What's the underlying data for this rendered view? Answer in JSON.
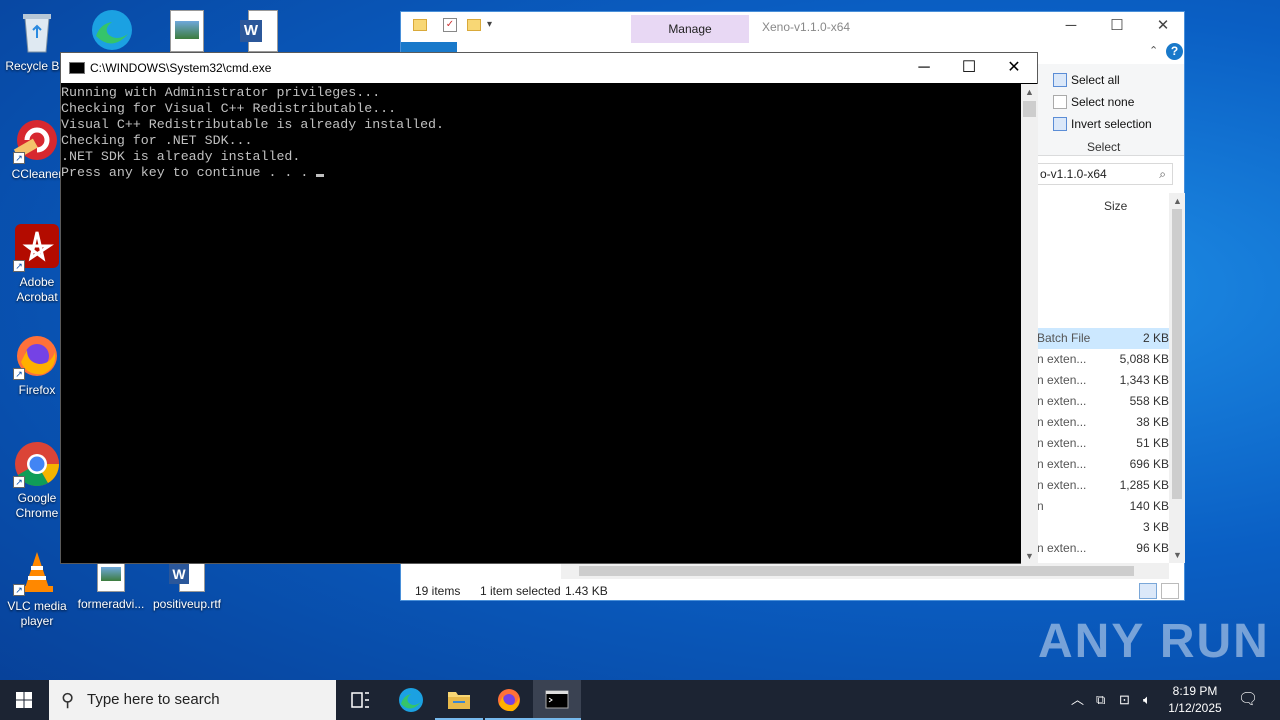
{
  "desktop": {
    "icons": [
      {
        "label": "Recycle Bin"
      },
      {
        "label": "CCleaner"
      },
      {
        "label": "Adobe Acrobat"
      },
      {
        "label": "Firefox"
      },
      {
        "label": "Google Chrome"
      },
      {
        "label": "VLC media player"
      },
      {
        "label": "formeradvi..."
      },
      {
        "label": "positiveup.rtf"
      }
    ]
  },
  "explorer": {
    "title": "Xeno-v1.1.0-x64",
    "manage_tab": "Manage",
    "ribbon": {
      "select_all": "Select all",
      "select_none": "Select none",
      "invert_selection": "Invert selection",
      "group_label": "Select"
    },
    "address_text": "o-v1.1.0-x64",
    "column_size": "Size",
    "files": [
      {
        "type": "Batch File",
        "size": "2 KB",
        "selected": true
      },
      {
        "type": "n exten...",
        "size": "5,088 KB"
      },
      {
        "type": "n exten...",
        "size": "1,343 KB"
      },
      {
        "type": "n exten...",
        "size": "558 KB"
      },
      {
        "type": "n exten...",
        "size": "38 KB"
      },
      {
        "type": "n exten...",
        "size": "51 KB"
      },
      {
        "type": "n exten...",
        "size": "696 KB"
      },
      {
        "type": "n exten...",
        "size": "1,285 KB"
      },
      {
        "type": "n",
        "size": "140 KB"
      },
      {
        "type": "",
        "size": "3 KB"
      },
      {
        "type": "n exten...",
        "size": "96 KB"
      }
    ],
    "status": {
      "items": "19 items",
      "selected": "1 item selected",
      "size": "1.43 KB"
    }
  },
  "cmd": {
    "title": "C:\\WINDOWS\\System32\\cmd.exe",
    "lines": [
      "Running with Administrator privileges...",
      "Checking for Visual C++ Redistributable...",
      "Visual C++ Redistributable is already installed.",
      "Checking for .NET SDK...",
      ".NET SDK is already installed.",
      "Press any key to continue . . . "
    ]
  },
  "watermark": "ANY RUN",
  "taskbar": {
    "search_placeholder": "Type here to search",
    "time": "8:19 PM",
    "date": "1/12/2025"
  },
  "colors": {
    "cmd_bg": "#000000",
    "cmd_text": "#c0c0c0",
    "accent": "#1979ca",
    "manage_tab": "#e8d8f4"
  }
}
